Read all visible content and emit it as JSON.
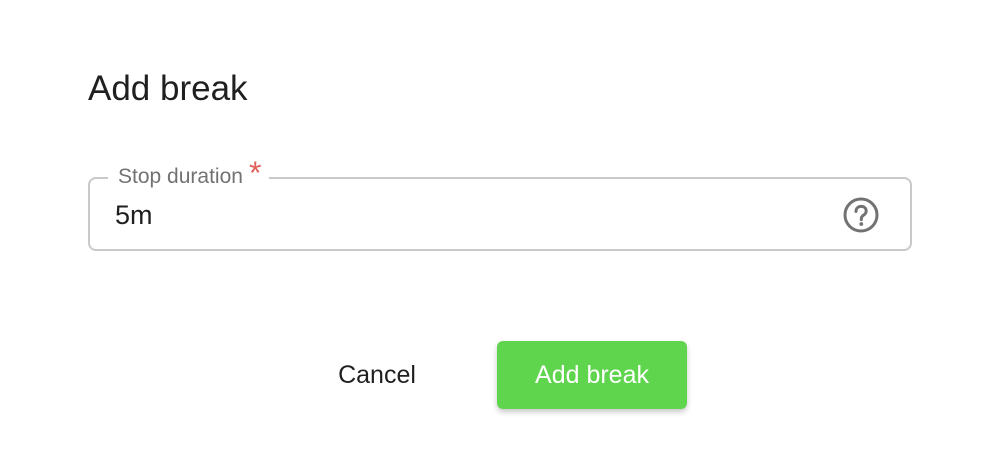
{
  "dialog": {
    "title": "Add break"
  },
  "field": {
    "label": "Stop duration",
    "required_mark": "*",
    "value": "5m",
    "help_icon": "question-circle-icon"
  },
  "actions": {
    "cancel_label": "Cancel",
    "primary_label": "Add break"
  },
  "colors": {
    "primary": "#5fd54d",
    "required": "#e0625a",
    "border": "#c9c9c9",
    "label": "#727272",
    "text": "#1f1f1f"
  }
}
